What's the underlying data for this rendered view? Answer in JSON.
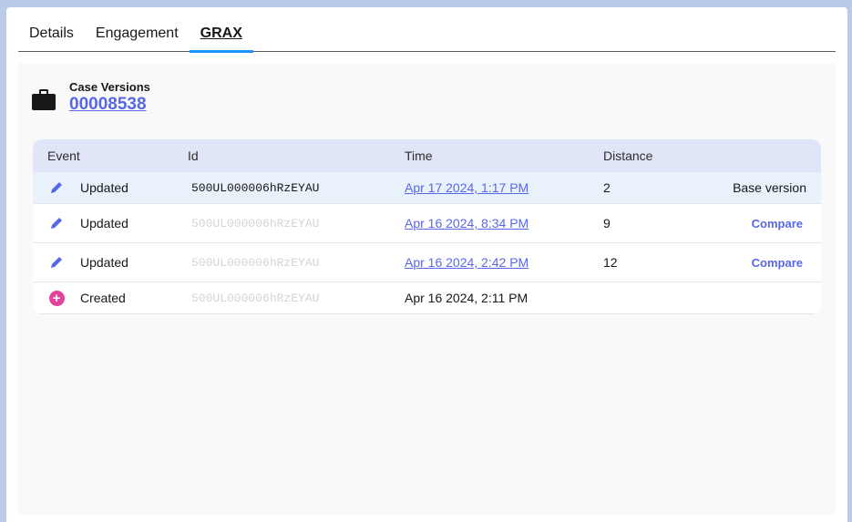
{
  "tabs": [
    {
      "label": "Details"
    },
    {
      "label": "Engagement"
    },
    {
      "label": "GRAX"
    }
  ],
  "header": {
    "label": "Case Versions",
    "number": "00008538",
    "icon": "briefcase-icon"
  },
  "table": {
    "columns": [
      "Event",
      "Id",
      "Time",
      "Distance",
      ""
    ],
    "rows": [
      {
        "event": "Updated",
        "icon": "pencil-icon",
        "id": "500UL000006hRzEYAU",
        "time": "Apr 17 2024, 1:17 PM",
        "distance": "2",
        "action": "Base version"
      },
      {
        "event": "Updated",
        "icon": "pencil-icon",
        "id": "500UL000006hRzEYAU",
        "time": "Apr 16 2024, 8:34 PM",
        "distance": "9",
        "action": "Compare"
      },
      {
        "event": "Updated",
        "icon": "pencil-icon",
        "id": "500UL000006hRzEYAU",
        "time": "Apr 16 2024, 2:42 PM",
        "distance": "12",
        "action": "Compare"
      },
      {
        "event": "Created",
        "icon": "plus-circle-icon",
        "id": "500UL000006hRzEYAU",
        "time": "Apr 16 2024, 2:11 PM",
        "distance": "",
        "action": ""
      }
    ]
  },
  "colors": {
    "accent": "#5867e8",
    "tab_underline": "#1b96ff",
    "header_bg": "#e0e5f8",
    "selected_row": "#e9f1fb",
    "created_icon": "#e3439b"
  }
}
